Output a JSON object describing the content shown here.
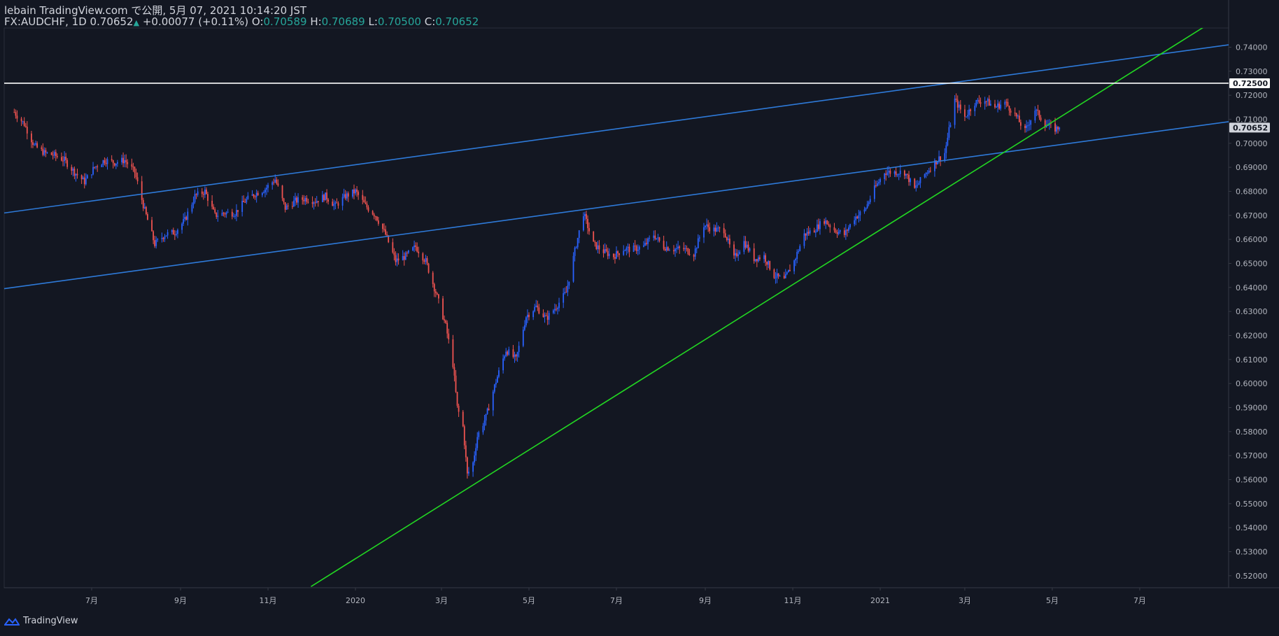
{
  "header": {
    "publisher": "lebain TradingView.com で公開, 5月 07, 2021 10:14:20 JST",
    "symbol": "FX:AUDCHF, 1D",
    "last": "0.70652",
    "change_arrow": "▲",
    "change": "+0.00077 (+0.11%)",
    "o_label": "O:",
    "o": "0.70589",
    "h_label": "H:",
    "h": "0.70689",
    "l_label": "L:",
    "l": "0.70500",
    "c_label": "C:",
    "c": "0.70652"
  },
  "footer": {
    "brand": "TradingView",
    "brand_icon": "tradingview-logo-icon"
  },
  "colors": {
    "background": "#131722",
    "up": "#2962ff",
    "down": "#ef5350",
    "channel": "#2e7ad9",
    "trendline": "#22d622",
    "hline": "#ffffff",
    "text": "#b2b5be"
  },
  "chart_data": {
    "type": "candlestick",
    "symbol": "FX:AUDCHF",
    "interval": "1D",
    "y_axis": {
      "range": [
        0.515,
        0.748
      ],
      "ticks": [
        0.52,
        0.53,
        0.54,
        0.55,
        0.56,
        0.57,
        0.58,
        0.59,
        0.6,
        0.61,
        0.62,
        0.63,
        0.64,
        0.65,
        0.66,
        0.67,
        0.68,
        0.69,
        0.7,
        0.71,
        0.72,
        0.73,
        0.74
      ],
      "tick_labels": [
        "0.52000",
        "0.53000",
        "0.54000",
        "0.55000",
        "0.56000",
        "0.57000",
        "0.58000",
        "0.59000",
        "0.60000",
        "0.61000",
        "0.62000",
        "0.63000",
        "0.64000",
        "0.65000",
        "0.66000",
        "0.67000",
        "0.68000",
        "0.69000",
        "0.70000",
        "0.71000",
        "0.72000",
        "0.73000",
        "0.74000"
      ],
      "price_labels": [
        {
          "value": 0.725,
          "text": "0.72500",
          "style": "line"
        },
        {
          "value": 0.70652,
          "text": "0.70652",
          "style": "last"
        }
      ]
    },
    "x_axis": {
      "tick_labels": [
        "7月",
        "9月",
        "11月",
        "2020",
        "3月",
        "5月",
        "7月",
        "9月",
        "11月",
        "2021",
        "3月",
        "5月",
        "7月"
      ],
      "tick_dates": [
        "2019-07-01",
        "2019-09-01",
        "2019-11-01",
        "2020-01-01",
        "2020-03-01",
        "2020-05-01",
        "2020-07-01",
        "2020-09-01",
        "2020-11-01",
        "2021-01-01",
        "2021-03-01",
        "2021-05-01",
        "2021-07-01"
      ]
    },
    "series": [
      {
        "name": "FX:AUDCHF",
        "points": [
          [
            "2019-05-08",
            0.713
          ],
          [
            "2019-05-15",
            0.708
          ],
          [
            "2019-05-22",
            0.699
          ],
          [
            "2019-05-29",
            0.696
          ],
          [
            "2019-06-05",
            0.695
          ],
          [
            "2019-06-12",
            0.693
          ],
          [
            "2019-06-19",
            0.688
          ],
          [
            "2019-06-26",
            0.684
          ],
          [
            "2019-07-03",
            0.69
          ],
          [
            "2019-07-10",
            0.693
          ],
          [
            "2019-07-17",
            0.692
          ],
          [
            "2019-07-24",
            0.693
          ],
          [
            "2019-07-31",
            0.688
          ],
          [
            "2019-08-07",
            0.672
          ],
          [
            "2019-08-14",
            0.658
          ],
          [
            "2019-08-21",
            0.662
          ],
          [
            "2019-08-28",
            0.663
          ],
          [
            "2019-09-04",
            0.668
          ],
          [
            "2019-09-11",
            0.678
          ],
          [
            "2019-09-18",
            0.68
          ],
          [
            "2019-09-25",
            0.67
          ],
          [
            "2019-10-02",
            0.671
          ],
          [
            "2019-10-09",
            0.671
          ],
          [
            "2019-10-16",
            0.676
          ],
          [
            "2019-10-23",
            0.679
          ],
          [
            "2019-10-30",
            0.681
          ],
          [
            "2019-11-06",
            0.685
          ],
          [
            "2019-11-13",
            0.673
          ],
          [
            "2019-11-20",
            0.676
          ],
          [
            "2019-11-27",
            0.677
          ],
          [
            "2019-12-04",
            0.676
          ],
          [
            "2019-12-11",
            0.678
          ],
          [
            "2019-12-18",
            0.674
          ],
          [
            "2019-12-25",
            0.678
          ],
          [
            "2020-01-01",
            0.68
          ],
          [
            "2020-01-08",
            0.674
          ],
          [
            "2020-01-15",
            0.67
          ],
          [
            "2020-01-22",
            0.662
          ],
          [
            "2020-01-29",
            0.651
          ],
          [
            "2020-02-05",
            0.653
          ],
          [
            "2020-02-12",
            0.657
          ],
          [
            "2020-02-19",
            0.651
          ],
          [
            "2020-02-26",
            0.638
          ],
          [
            "2020-03-04",
            0.624
          ],
          [
            "2020-03-09",
            0.608
          ],
          [
            "2020-03-12",
            0.59
          ],
          [
            "2020-03-16",
            0.582
          ],
          [
            "2020-03-19",
            0.562
          ],
          [
            "2020-03-23",
            0.567
          ],
          [
            "2020-03-26",
            0.578
          ],
          [
            "2020-04-01",
            0.586
          ],
          [
            "2020-04-08",
            0.601
          ],
          [
            "2020-04-15",
            0.614
          ],
          [
            "2020-04-22",
            0.61
          ],
          [
            "2020-04-29",
            0.628
          ],
          [
            "2020-05-06",
            0.632
          ],
          [
            "2020-05-13",
            0.627
          ],
          [
            "2020-05-20",
            0.632
          ],
          [
            "2020-05-27",
            0.638
          ],
          [
            "2020-06-03",
            0.658
          ],
          [
            "2020-06-08",
            0.671
          ],
          [
            "2020-06-15",
            0.658
          ],
          [
            "2020-06-22",
            0.655
          ],
          [
            "2020-06-29",
            0.653
          ],
          [
            "2020-07-06",
            0.656
          ],
          [
            "2020-07-13",
            0.656
          ],
          [
            "2020-07-20",
            0.657
          ],
          [
            "2020-07-27",
            0.662
          ],
          [
            "2020-08-03",
            0.657
          ],
          [
            "2020-08-10",
            0.656
          ],
          [
            "2020-08-17",
            0.656
          ],
          [
            "2020-08-24",
            0.654
          ],
          [
            "2020-08-31",
            0.666
          ],
          [
            "2020-09-07",
            0.664
          ],
          [
            "2020-09-14",
            0.664
          ],
          [
            "2020-09-21",
            0.652
          ],
          [
            "2020-09-28",
            0.659
          ],
          [
            "2020-10-05",
            0.652
          ],
          [
            "2020-10-12",
            0.653
          ],
          [
            "2020-10-19",
            0.645
          ],
          [
            "2020-10-26",
            0.643
          ],
          [
            "2020-11-02",
            0.651
          ],
          [
            "2020-11-09",
            0.662
          ],
          [
            "2020-11-16",
            0.664
          ],
          [
            "2020-11-23",
            0.668
          ],
          [
            "2020-11-30",
            0.664
          ],
          [
            "2020-12-07",
            0.662
          ],
          [
            "2020-12-14",
            0.669
          ],
          [
            "2020-12-21",
            0.672
          ],
          [
            "2020-12-28",
            0.681
          ],
          [
            "2021-01-04",
            0.688
          ],
          [
            "2021-01-11",
            0.688
          ],
          [
            "2021-01-18",
            0.688
          ],
          [
            "2021-01-25",
            0.681
          ],
          [
            "2021-02-01",
            0.687
          ],
          [
            "2021-02-08",
            0.692
          ],
          [
            "2021-02-15",
            0.696
          ],
          [
            "2021-02-22",
            0.718
          ],
          [
            "2021-03-01",
            0.711
          ],
          [
            "2021-03-08",
            0.717
          ],
          [
            "2021-03-15",
            0.718
          ],
          [
            "2021-03-22",
            0.715
          ],
          [
            "2021-03-29",
            0.717
          ],
          [
            "2021-04-05",
            0.712
          ],
          [
            "2021-04-12",
            0.705
          ],
          [
            "2021-04-19",
            0.714
          ],
          [
            "2021-04-26",
            0.708
          ],
          [
            "2021-05-03",
            0.706
          ],
          [
            "2021-05-06",
            0.70652
          ]
        ]
      }
    ],
    "drawings": [
      {
        "type": "trend_line",
        "color": "blue",
        "points": [
          [
            "2019-05-01",
            0.671
          ],
          [
            "2021-09-01",
            0.741
          ]
        ]
      },
      {
        "type": "trend_line",
        "color": "blue",
        "points": [
          [
            "2019-05-01",
            0.6395
          ],
          [
            "2021-09-01",
            0.709
          ]
        ]
      },
      {
        "type": "trend_line",
        "color": "green",
        "points": [
          [
            "2019-12-01",
            0.5155
          ],
          [
            "2021-08-15",
            0.7485
          ]
        ]
      },
      {
        "type": "horizontal_line",
        "color": "white",
        "value": 0.725
      }
    ]
  }
}
